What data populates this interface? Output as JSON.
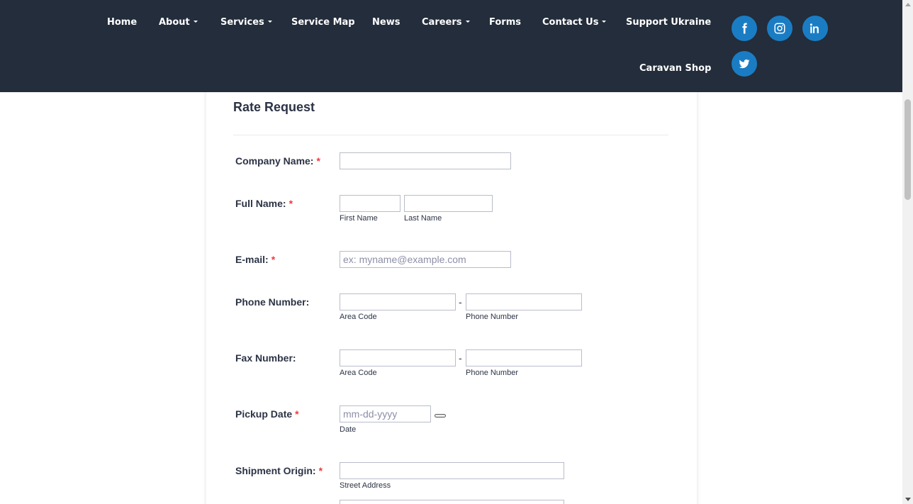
{
  "nav": {
    "home": "Home",
    "about": "About",
    "services": "Services",
    "service_map": "Service Map",
    "news": "News",
    "careers": "Careers",
    "forms": "Forms",
    "contact_us": "Contact Us",
    "support_ukraine": "Support Ukraine",
    "caravan_shop": "Caravan Shop"
  },
  "social": [
    "facebook-icon",
    "instagram-icon",
    "linkedin-icon",
    "twitter-icon"
  ],
  "colors": {
    "header_bg": "#232d3b",
    "social_bg": "#1a7dc4",
    "required": "#f23a3c",
    "text": "#2c3345"
  },
  "form": {
    "title": "Rate Request",
    "required_mark": "*",
    "company_name": {
      "label": "Company Name:",
      "value": ""
    },
    "full_name": {
      "label": "Full Name:",
      "first_sub": "First Name",
      "last_sub": "Last Name"
    },
    "email": {
      "label": "E-mail:",
      "placeholder": "ex: myname@example.com"
    },
    "phone": {
      "label": "Phone Number:",
      "area_sub": "Area Code",
      "number_sub": "Phone Number",
      "separator": "-"
    },
    "fax": {
      "label": "Fax Number:",
      "area_sub": "Area Code",
      "number_sub": "Phone Number",
      "separator": "-"
    },
    "pickup_date": {
      "label": "Pickup Date",
      "placeholder": "mm-dd-yyyy",
      "sub": "Date"
    },
    "shipment_origin": {
      "label": "Shipment Origin:",
      "street_sub": "Street Address"
    }
  }
}
